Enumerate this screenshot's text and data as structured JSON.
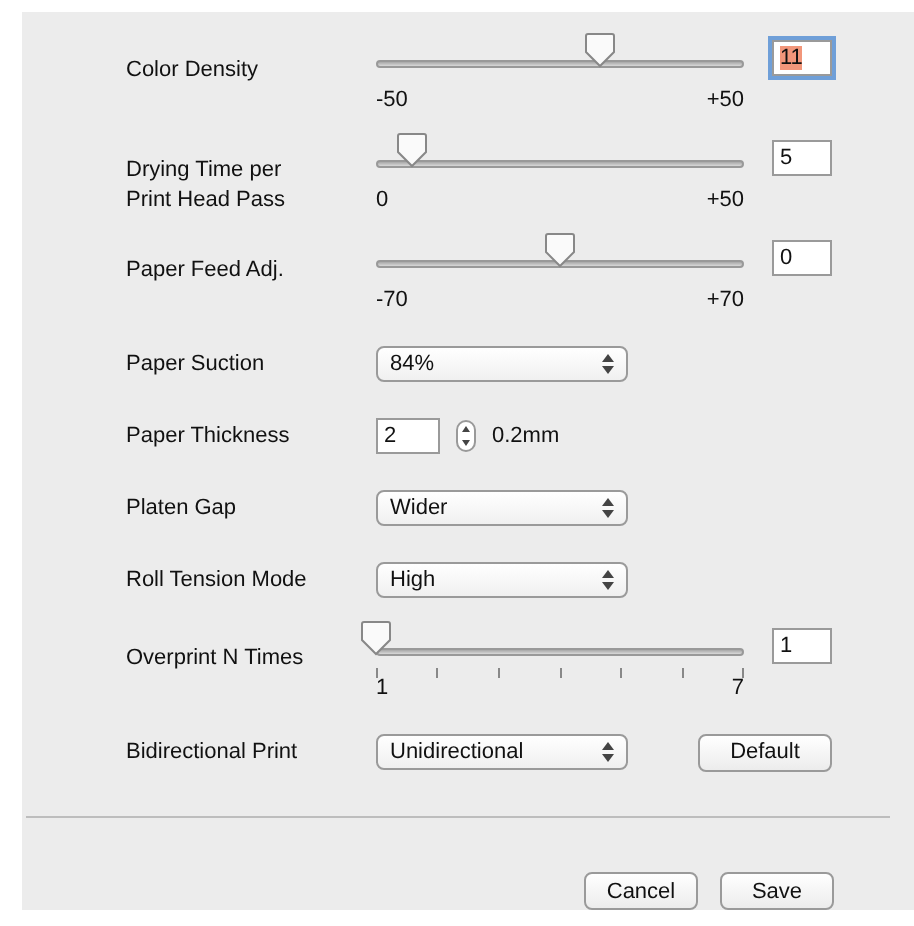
{
  "settings": [
    {
      "kind": "slider",
      "label": "Color Density",
      "level": 0.61,
      "min_label": "-50",
      "max_label": "+50",
      "value": "11",
      "value_selected": true
    },
    {
      "kind": "slider",
      "label": "Drying Time per Print Head Pass",
      "level": 0.1,
      "min_label": "0",
      "max_label": "+50",
      "value": "5",
      "value_selected": false
    },
    {
      "kind": "slider",
      "label": "Paper Feed Adj.",
      "level": 0.5,
      "min_label": "-70",
      "max_label": "+70",
      "value": "0",
      "value_selected": false
    },
    {
      "kind": "popup",
      "label": "Paper Suction",
      "value": "84%"
    },
    {
      "kind": "stepper",
      "label": "Paper Thickness",
      "value": "2",
      "unit": "0.2mm"
    },
    {
      "kind": "popup",
      "label": "Platen Gap",
      "value": "Wider"
    },
    {
      "kind": "popup",
      "label": "Roll Tension Mode",
      "value": "High"
    },
    {
      "kind": "slider",
      "label": "Overprint N Times",
      "level": 0,
      "min_label": "1",
      "max_label": "7",
      "value": "1",
      "value_selected": false,
      "ticks": true
    },
    {
      "kind": "popup",
      "label": "Bidirectional Print",
      "value": "Unidirectional",
      "button": "Default"
    }
  ],
  "buttons": [
    "Cancel",
    "Save"
  ]
}
